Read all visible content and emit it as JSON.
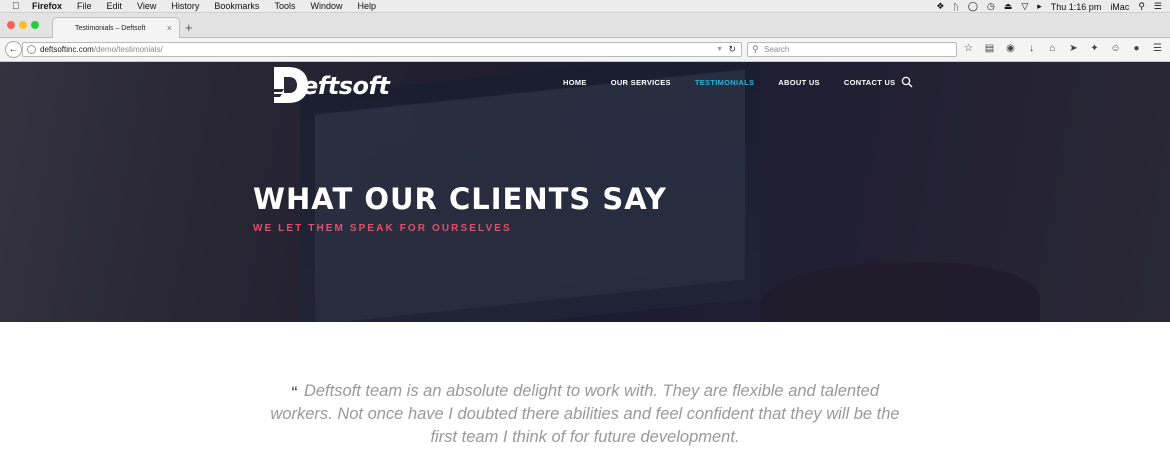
{
  "menubar": {
    "app": "Firefox",
    "items": [
      "File",
      "Edit",
      "View",
      "History",
      "Bookmarks",
      "Tools",
      "Window",
      "Help"
    ],
    "clock": "Thu 1:16 pm",
    "user": "iMac"
  },
  "browser": {
    "tab_title": "Testimonials – Deftsoft",
    "url_host": "deftsoftinc.com",
    "url_path": "/demo/testimonials/",
    "search_placeholder": "Search"
  },
  "site": {
    "logo_text": "eftsoft",
    "logo_letter": "D",
    "nav": [
      {
        "label": "HOME",
        "active": false
      },
      {
        "label": "OUR SERVICES",
        "active": false
      },
      {
        "label": "TESTIMONIALS",
        "active": true
      },
      {
        "label": "ABOUT US",
        "active": false
      },
      {
        "label": "CONTACT US",
        "active": false
      }
    ],
    "hero_title": "WHAT OUR CLIENTS SAY",
    "hero_subtitle": "WE LET THEM SPEAK FOR OURSELVES",
    "quote_mark": "“",
    "quote_text": "Deftsoft team is an absolute delight to work with. They are flexible and talented workers. Not once have I doubted there abilities and feel confident that they will be the first team I think of for future development."
  },
  "colors": {
    "accent_active_nav": "#1fb5d9",
    "subtitle_pink": "#e34e6c",
    "quote_gray": "#999999"
  }
}
